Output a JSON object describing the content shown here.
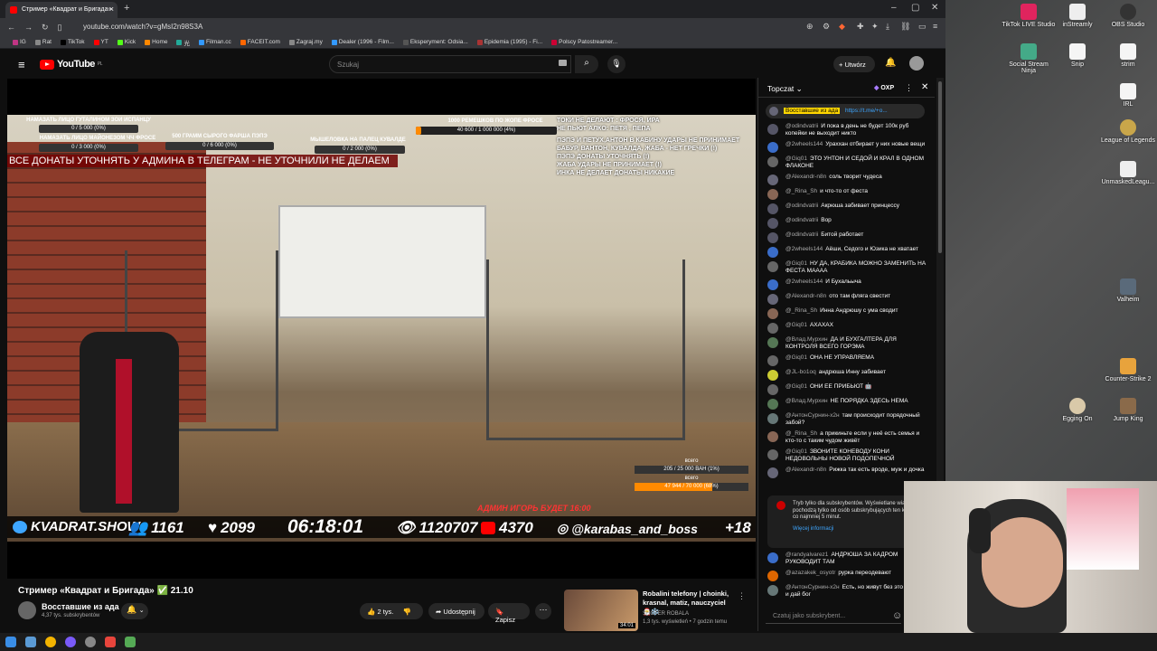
{
  "browser": {
    "tab_title": "Стример «Квадрат и Бригада»",
    "url": "youtube.com/watch?v=gMsI2n98S3A",
    "bookmarks": [
      "IG",
      "Rat",
      "TikTok",
      "YT",
      "Kick",
      "Home",
      "光",
      "Filman.cc",
      "FACEIT.com",
      "Zagraj.my",
      "Dealer (1996 - Film...",
      "Eksperyment: Odsia...",
      "Epidemia (1995) - Fi...",
      "Polscy Patostreamer..."
    ]
  },
  "youtube": {
    "logo_text": "YouTube",
    "logo_region": "PL",
    "search_placeholder": "Szukaj",
    "create_label": "Utwórz"
  },
  "overlay": {
    "goal1_label": "НАМАЗАТЬ ЛИЦО ГУТАЛИНОМ ЗОИ ИСПАНЦУ",
    "goal1_value": "0 / 5 000 (0%)",
    "goal2_label": "НАМАЗАТЬ ЛИЦО МАЙОНЕЗОМ ЧЧ ФРОСЕ",
    "goal2_value": "0 / 3 000 (0%)",
    "goal3_label": "500 ГРАММ СЫРОГО ФАРША ПЭПЭ",
    "goal3_value": "0 / 6 000 (0%)",
    "goal4_label": "МЫШЕЛОВКА НА ПАЛЕЦ КУВАЛДЕ",
    "goal4_value": "0 / 2 000 (0%)",
    "goal5_label": "1000 РЕМЕШКОВ ПО ЖОПЕ ФРОСЕ",
    "goal5_value": "40 600 / 1 000 000 (4%)",
    "goal5_progress": 0.04,
    "banner": "ВСЕ ДОНАТЫ УТОЧНЯТЬ У АДМИНА В ТЕЛЕГРАМ - НЕ УТОЧНИЛИ НЕ ДЕЛАЕМ",
    "notes": [
      "ТОКИ НЕ ДЕЛАЮТ : ФРОСЯ, ИРА",
      "НЕ ПЬЮТ АЛКО: ПЕТЯ , ПЕПА",
      "",
      "ПЭПЭ И ПЕТУХ,АНТОН В КАБИНУ УДАРЫ НЕ ПРИНИМАЕТ",
      "БАБУР, ВАНТОН, КУВАЛДА, ЖАБА -  НЕТ ГРЕЧКИ (!)",
      "ПЭПЭ ДОНАТЫ УТОЧНЯТЬ (!)",
      "ЖАБА УДАРЫ НЕ ПРИНИМАЕТ (!)",
      "ИНКА НЕ ДЕЛАЕТ ДОНАТЫ НИКАКИЕ"
    ],
    "admin_line": "АДМИН ИГОРЬ БУДЕТ 16:00",
    "box_total_label": "всего",
    "box_goal1": "205 / 25 000 ВАН (1%)",
    "box_total_label2": "всего",
    "box_goal2": "47 944 / 70 000 (68%)",
    "box_goal2_progress": 0.68,
    "site": "KVADRAT.SHOW",
    "viewers": "1161",
    "likes": "2099",
    "time": "06:18:01",
    "views": "1120707",
    "yt_subs": "4370",
    "instagram": "@karabas_and_boss",
    "age": "+18"
  },
  "video_info": {
    "title": "Стример «Квадрат и Бригада» ✅ 21.10",
    "channel": "Восставшие из ада",
    "subscribers": "4,37 tys. subskrybentów",
    "likes": "2 tys.",
    "share": "Udostępnij",
    "save": "Zapisz"
  },
  "recommended": {
    "title": "Robalini telefony | choinki, krasnal, matiz, nauczyciel 🎅❄️",
    "channel": "SHOTER ROBALA",
    "meta": "1,3 tys. wyświetleń • 7 godzin temu",
    "duration": "34:01"
  },
  "chat": {
    "title": "Topczat",
    "badge": "OXP",
    "pinned_tag": "Восставшие из ада",
    "pinned_link": "https://t.me/+o...",
    "messages": [
      {
        "author": "@odindvatrii",
        "text": "И пока в день не будет 100к руб копейки не выходит никто",
        "color": "#556"
      },
      {
        "author": "@2wheels144",
        "text": "Ураххан отбирает у них новые вещи",
        "color": "#3a6dc9"
      },
      {
        "author": "@Giq01",
        "text": "ЭТО УНТОН И СЕДОЙ И КРАЛ В ОДНОМ ФЛАКОНЕ",
        "color": "#666"
      },
      {
        "author": "@Alexandr-n8n",
        "text": "соль творит чудеса",
        "color": "#667"
      },
      {
        "author": "@_Rina_Sh",
        "text": "и что-то от феста",
        "color": "#865"
      },
      {
        "author": "@odindvatrii",
        "text": "Акрюша забивает принцессу",
        "color": "#556"
      },
      {
        "author": "@odindvatrii",
        "text": "Вор",
        "color": "#556"
      },
      {
        "author": "@odindvatrii",
        "text": "Битой работает",
        "color": "#556"
      },
      {
        "author": "@2wheels144",
        "text": "Аёши, Седого и Юзика не хватает",
        "color": "#3a6dc9"
      },
      {
        "author": "@Giq01",
        "text": "НУ ДА, КРАБИКА МОЖНО ЗАМЕНИТЬ НА ФЕСТА МАААА",
        "color": "#666"
      },
      {
        "author": "@2wheels144",
        "text": "И Бухальыча",
        "color": "#3a6dc9"
      },
      {
        "author": "@Alexandr-n8n",
        "text": "ото там фляга свестит",
        "color": "#667"
      },
      {
        "author": "@_Rina_Sh",
        "text": "Инна Андрюшу с ума сводит",
        "color": "#865"
      },
      {
        "author": "@Giq01",
        "text": "АХАХАХ",
        "color": "#666"
      },
      {
        "author": "@Влад.Мурхин",
        "text": "ДА И БУХГАЛТЕРА ДЛЯ КОНТРОЛЯ ВСЕГО ГОРЭМА",
        "color": "#575"
      },
      {
        "author": "@Giq01",
        "text": "ОНА НЕ УПРАВЛЯЕМА",
        "color": "#666"
      },
      {
        "author": "@JL-bo1oq",
        "text": "андрюша Инну забивает",
        "color": "#cc3"
      },
      {
        "author": "@Giq01",
        "text": "ОНИ ЕЕ ПРИБЬЮТ 🤖",
        "color": "#666"
      },
      {
        "author": "@Влад.Мурхин",
        "text": "НЕ ПОРЯДКА ЗДЕСЬ НЕМА",
        "color": "#575"
      },
      {
        "author": "@АнтонСурнин-х2н",
        "text": "там происходит порядочный забой?",
        "color": "#677"
      },
      {
        "author": "@_Rina_Sh",
        "text": "а прикиньте если у неё есть семья и кто-то с таким чудом живёт",
        "color": "#865"
      },
      {
        "author": "@Giq01",
        "text": "ЗВОНИТЕ КОНЕВОДУ КОНИ НЕДОВОЛЬНЫ НОВОЙ ПОДОПЕЧНОЙ",
        "color": "#666"
      },
      {
        "author": "@Alexandr-n8n",
        "text": "Рижка так есть вроде, муж и дочка",
        "color": "#667"
      }
    ],
    "sub_notice": "Tryb tylko dla subskrybentów. Wyświetlane wiadomości pochodzą tylko od osób subskrybujących ten kanał od co najmniej 5 minut.",
    "sub_more": "Więcej informacji",
    "messages2": [
      {
        "author": "@randyalvarez1",
        "text": "АНДРЮША ЗА КАДРОМ РУКОВОДИТ ТАМ",
        "color": "#3a6dc9"
      },
      {
        "author": "@azazakek_osyotr",
        "text": "рурка переодевают",
        "color": "#d60"
      },
      {
        "author": "@АнтонСурнин-х2н",
        "text": "Есть, но живут без это мымры, и дай бог",
        "color": "#677"
      }
    ],
    "input_placeholder": "Czatuj jako subskrybent..."
  },
  "desktop_icons": [
    "TikTok LIVE Studio",
    "inStreamly",
    "OBS Studio",
    "Social Stream Ninja",
    "Snip",
    "strim",
    "IRL",
    "League of Legends",
    "UnmaskedLeagu...",
    "Valheim",
    "Counter-Strike 2",
    "Egging On",
    "Jump King"
  ]
}
